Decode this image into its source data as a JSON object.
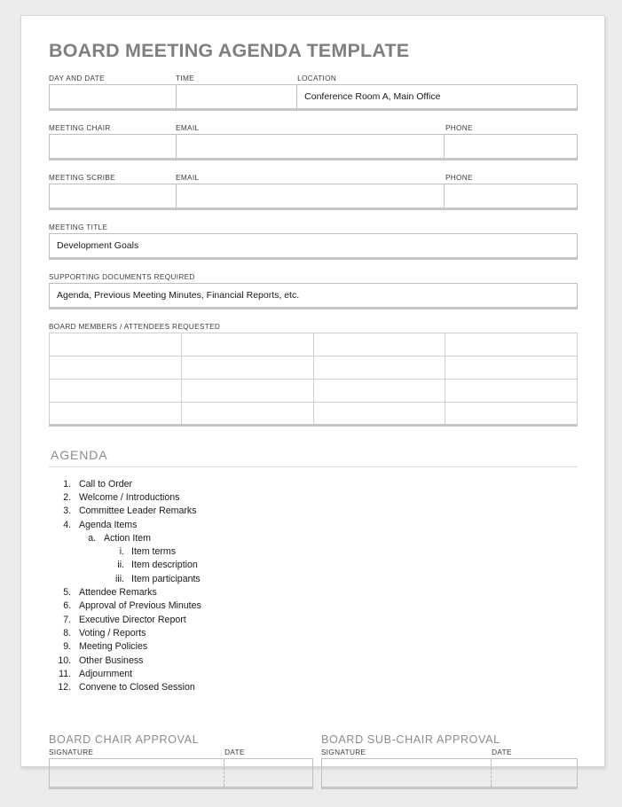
{
  "document": {
    "title": "BOARD MEETING AGENDA TEMPLATE"
  },
  "info_row_1": {
    "labels": {
      "day_and_date": "DAY AND DATE",
      "time": "TIME",
      "location": "LOCATION"
    },
    "values": {
      "day_and_date": "",
      "time": "",
      "location": "Conference Room A, Main Office"
    }
  },
  "meeting_chair": {
    "labels": {
      "name": "MEETING CHAIR",
      "email": "EMAIL",
      "phone": "PHONE"
    },
    "values": {
      "name": "",
      "email": "",
      "phone": ""
    }
  },
  "meeting_scribe": {
    "labels": {
      "name": "MEETING SCRIBE",
      "email": "EMAIL",
      "phone": "PHONE"
    },
    "values": {
      "name": "",
      "email": "",
      "phone": ""
    }
  },
  "meeting_title": {
    "label": "MEETING TITLE",
    "value": "Development Goals"
  },
  "supporting_documents": {
    "label": "SUPPORTING DOCUMENTS REQUIRED",
    "value": "Agenda, Previous Meeting Minutes, Financial Reports, etc."
  },
  "attendees": {
    "label": "BOARD MEMBERS / ATTENDEES REQUESTED",
    "columns": 4,
    "rows": [
      [
        "",
        "",
        "",
        ""
      ],
      [
        "",
        "",
        "",
        ""
      ],
      [
        "",
        "",
        "",
        ""
      ],
      [
        "",
        "",
        "",
        ""
      ]
    ]
  },
  "agenda": {
    "heading": "AGENDA",
    "items": [
      {
        "text": "Call to Order"
      },
      {
        "text": "Welcome / Introductions"
      },
      {
        "text": "Committee Leader Remarks"
      },
      {
        "text": "Agenda Items",
        "children": [
          {
            "text": "Action Item",
            "children": [
              {
                "text": "Item terms"
              },
              {
                "text": "Item description"
              },
              {
                "text": "Item participants"
              }
            ]
          }
        ]
      },
      {
        "text": "Attendee Remarks"
      },
      {
        "text": "Approval of Previous Minutes"
      },
      {
        "text": "Executive Director Report"
      },
      {
        "text": "Voting / Reports"
      },
      {
        "text": "Meeting Policies"
      },
      {
        "text": "Other Business"
      },
      {
        "text": "Adjournment"
      },
      {
        "text": "Convene to Closed Session"
      }
    ]
  },
  "approvals": {
    "chair": {
      "heading": "BOARD CHAIR APPROVAL",
      "signature_label": "SIGNATURE",
      "date_label": "DATE",
      "signature_value": "",
      "date_value": ""
    },
    "sub_chair": {
      "heading": "BOARD SUB-CHAIR APPROVAL",
      "signature_label": "SIGNATURE",
      "date_label": "DATE",
      "signature_value": "",
      "date_value": ""
    }
  },
  "colors": {
    "title_gray": "#7f7f7f",
    "heading_gray": "#8c8c8c",
    "border_gray": "#bfbfbf",
    "shadow_gray": "#c6c6c6",
    "page_background": "#ececec",
    "paper": "#ffffff"
  }
}
